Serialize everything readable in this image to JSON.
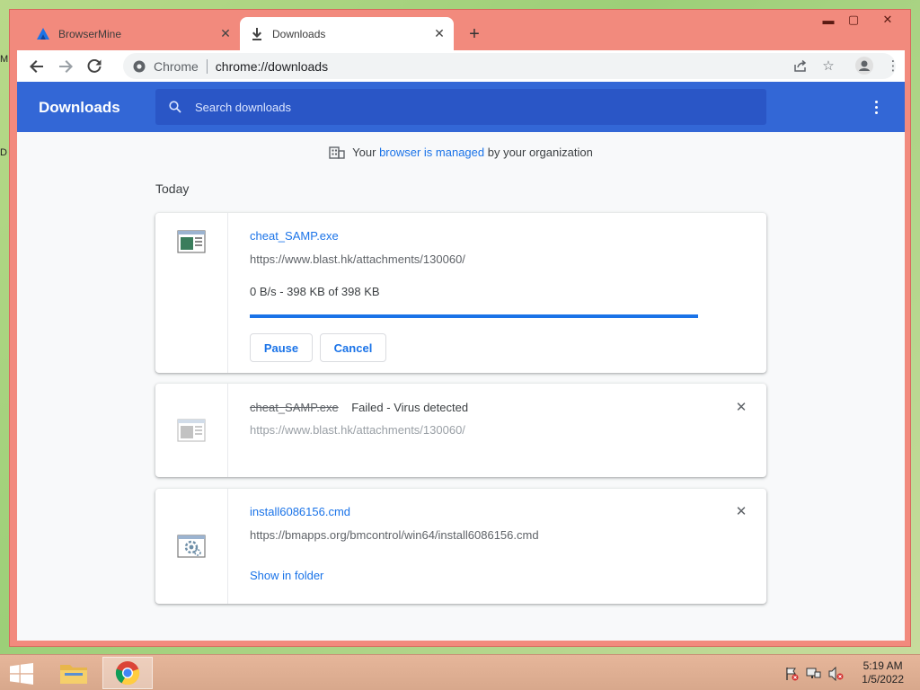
{
  "desktop": {
    "icon_labels": [
      "M",
      "D"
    ]
  },
  "tabs": [
    {
      "title": "BrowserMine",
      "icon": "browsermine-logo-icon",
      "active": false
    },
    {
      "title": "Downloads",
      "icon": "download-icon",
      "active": true
    }
  ],
  "address_bar": {
    "site_label": "Chrome",
    "url": "chrome://downloads"
  },
  "downloads_page": {
    "title": "Downloads",
    "search_placeholder": "Search downloads",
    "managed_notice": {
      "prefix": "Your ",
      "link": "browser is managed",
      "suffix": " by your organization"
    },
    "section": "Today",
    "items": [
      {
        "filename": "cheat_SAMP.exe",
        "url": "https://www.blast.hk/attachments/130060/",
        "status": "0 B/s - 398 KB of 398 KB",
        "progress_percent": 100,
        "buttons": [
          "Pause",
          "Cancel"
        ]
      },
      {
        "filename": "cheat_SAMP.exe",
        "failed_status": "Failed - Virus detected",
        "url": "https://www.blast.hk/attachments/130060/"
      },
      {
        "filename": "install6086156.cmd",
        "url": "https://bmapps.org/bmcontrol/win64/install6086156.cmd",
        "link": "Show in folder"
      }
    ]
  },
  "taskbar": {
    "time": "5:19 AM",
    "date": "1/5/2022"
  },
  "colors": {
    "header": "#3367d6",
    "search": "#2a56c6",
    "accent": "#1a73e8",
    "window_frame": "#f28a7d"
  }
}
